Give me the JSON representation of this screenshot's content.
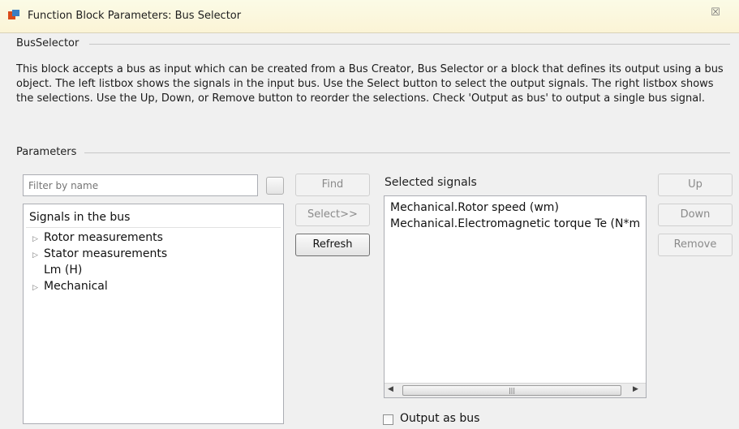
{
  "window": {
    "title": "Function Block Parameters: Bus Selector",
    "close_glyph": "☒"
  },
  "block": {
    "name": "BusSelector",
    "description": "This block accepts a bus as input which can be created from a Bus Creator, Bus Selector or a block that defines its output using a bus object. The left listbox shows the signals in the input bus. Use the Select button to select the output signals. The right listbox shows the selections. Use the Up, Down, or Remove button to reorder the selections. Check 'Output as bus' to output a single bus signal."
  },
  "parameters": {
    "label": "Parameters",
    "filter": {
      "value": "",
      "placeholder": "Filter by name"
    },
    "find_label": "Find",
    "select_label": "Select>>",
    "refresh_label": "Refresh",
    "signals_header": "Signals in the bus",
    "signals": [
      {
        "label": "Rotor measurements",
        "expandable": true
      },
      {
        "label": "Stator measurements",
        "expandable": true
      },
      {
        "label": "Lm (H)",
        "expandable": false
      },
      {
        "label": "Mechanical",
        "expandable": true
      }
    ],
    "selected_header": "Selected signals",
    "selected": [
      "Mechanical.Rotor speed (wm)",
      "Mechanical.Electromagnetic torque Te (N*m"
    ],
    "up_label": "Up",
    "down_label": "Down",
    "remove_label": "Remove",
    "output_as_bus_label": "Output as bus",
    "output_as_bus_checked": false
  }
}
